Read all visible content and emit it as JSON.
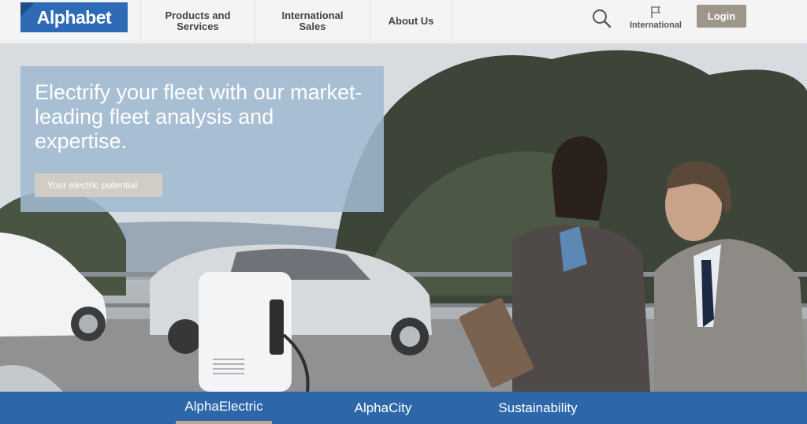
{
  "header": {
    "logo_text": "Alphabet",
    "nav": {
      "products": "Products and Services",
      "international_sales": "International Sales",
      "about": "About Us"
    },
    "international_label": "International",
    "login_label": "Login"
  },
  "hero": {
    "title": "Electrify your fleet with our market-leading fleet analysis and expertise.",
    "cta_label": "Your electric potential"
  },
  "tabs": {
    "items": [
      {
        "label": "AlphaElectric",
        "active": true
      },
      {
        "label": "AlphaCity",
        "active": false
      },
      {
        "label": "Sustainability",
        "active": false
      }
    ]
  },
  "colors": {
    "brand_blue": "#2e6ab5",
    "tabbar_blue": "#2e67a9",
    "login_bg": "#9e958b",
    "panel_blue": "#a0bad0"
  },
  "icons": {
    "search": "search-icon",
    "international": "flag-icon"
  }
}
